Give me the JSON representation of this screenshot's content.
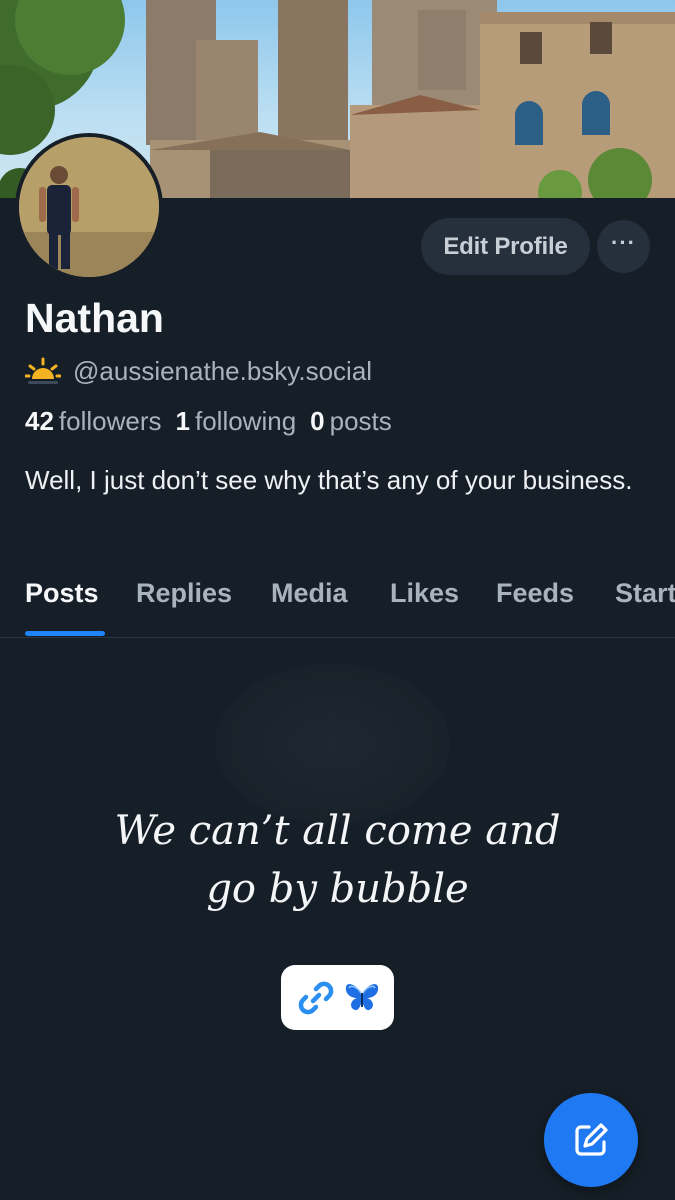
{
  "profile": {
    "display_name": "Nathan",
    "handle": "@aussienathe.bsky.social",
    "bio": "Well, I just don’t see why that’s any of your business."
  },
  "stats": {
    "followers_count": "42",
    "followers_label": "followers",
    "following_count": "1",
    "following_label": "following",
    "posts_count": "0",
    "posts_label": "posts"
  },
  "header": {
    "edit_profile_label": "Edit Profile",
    "more_label": "···"
  },
  "tabs": [
    {
      "label": "Posts",
      "active": true
    },
    {
      "label": "Replies",
      "active": false
    },
    {
      "label": "Media",
      "active": false
    },
    {
      "label": "Likes",
      "active": false
    },
    {
      "label": "Feeds",
      "active": false
    },
    {
      "label": "Starter Packs",
      "active": false
    }
  ],
  "empty_state": {
    "line1": "We can’t all come and",
    "line2": "go by bubble"
  },
  "icons": {
    "handle_emoji": "sunrise-icon",
    "link_chip": [
      "link-icon",
      "butterfly-icon"
    ],
    "fab": "compose-icon",
    "more": "ellipsis-icon"
  },
  "colors": {
    "background": "#161e27",
    "accent": "#1f84f5",
    "button_bg": "#25303c",
    "muted_text": "#a9b3be"
  }
}
